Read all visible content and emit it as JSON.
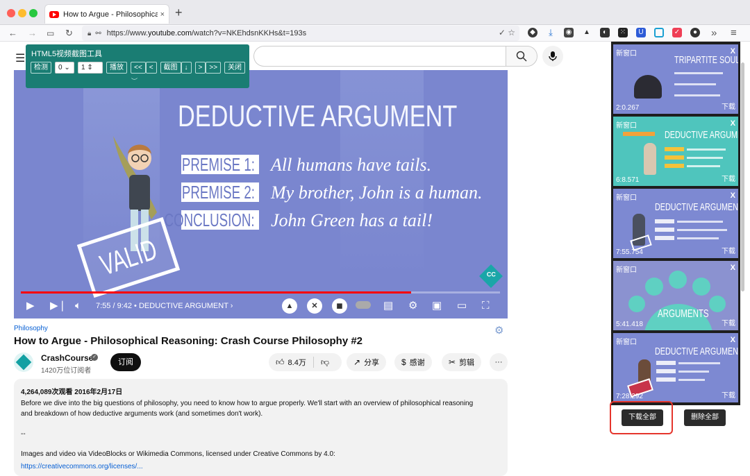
{
  "browser": {
    "tab_title": "How to Argue - Philosophical Reasoning",
    "tab_close": "×",
    "new_tab": "+",
    "url_prefix": "https://www.",
    "url_domain": "youtube.com",
    "url_rest": "/watch?v=NKEhdsnKKHs&t=193s",
    "menu": "≡",
    "overflow": "»"
  },
  "tool": {
    "title": "HTML5视频截图工具",
    "detect": "检测",
    "select_value": "0",
    "input_value": "1",
    "play": "播放",
    "back": "<<",
    "prev": "<",
    "capture": "截图",
    "down": "↓",
    "next": ">",
    "fwd": ">>",
    "close": "关闭"
  },
  "video": {
    "slide_title": "DEDUCTIVE ARGUMENT",
    "premises": [
      {
        "label": "PREMISE 1:",
        "text": "All humans have tails."
      },
      {
        "label": "PREMISE 2:",
        "text": "My brother, John is a human."
      },
      {
        "label": "CONCLUSION:",
        "text": "John Green has a tail!"
      }
    ],
    "stamp": "VALID",
    "time": "7:55 / 9:42",
    "chapter": "DEDUCTIVE ARGUMENT",
    "progress": 0.815,
    "buffered": 0.97
  },
  "page": {
    "category": "Philosophy",
    "title": "How to Argue - Philosophical Reasoning: Crash Course Philosophy #2",
    "channel": "CrashCourse",
    "subscribers": "1420万位订阅者",
    "subscribe": "订阅",
    "likes": "8.4万",
    "share": "分享",
    "thanks": "感谢",
    "clip": "剪辑",
    "more": "···",
    "stats": "4,264,089次观看  2016年2月17日",
    "desc_line1": "Before we dive into the big questions of philosophy, you need to know how to argue properly. We'll start with an overview of philosophical reasoning",
    "desc_line2": "and breakdown of how deductive arguments work (and sometimes don't work).",
    "desc_dash": "--",
    "desc_line3": "Images and video via VideoBlocks or Wikimedia Commons, licensed under Creative Commons by 4.0:",
    "desc_link": "https://creativecommons.org/licenses/..."
  },
  "captures": {
    "items": [
      {
        "new_window": "新窗口",
        "close": "X",
        "time": "2:0.267",
        "download": "下载",
        "title": "TRIPARTITE SOUL"
      },
      {
        "new_window": "新窗口",
        "close": "X",
        "time": "6:8.571",
        "download": "下载",
        "title": "DEDUCTIVE ARGUMENT"
      },
      {
        "new_window": "新窗口",
        "close": "X",
        "time": "7:55.754",
        "download": "下载",
        "title": "DEDUCTIVE ARGUMENT"
      },
      {
        "new_window": "新窗口",
        "close": "X",
        "time": "5:41.418",
        "download": "下载",
        "title": "ARGUMENTS"
      },
      {
        "new_window": "新窗口",
        "close": "X",
        "time": "7:28.292",
        "download": "下载",
        "title": "DEDUCTIVE ARGUMENT"
      }
    ],
    "download_all": "下载全部",
    "delete_all": "删除全部"
  },
  "colors": {
    "slide_bg": "#7a86cf",
    "teal_tool": "#1a7d73",
    "youtube_red": "#ff0000",
    "highlight": "#e5352c"
  }
}
